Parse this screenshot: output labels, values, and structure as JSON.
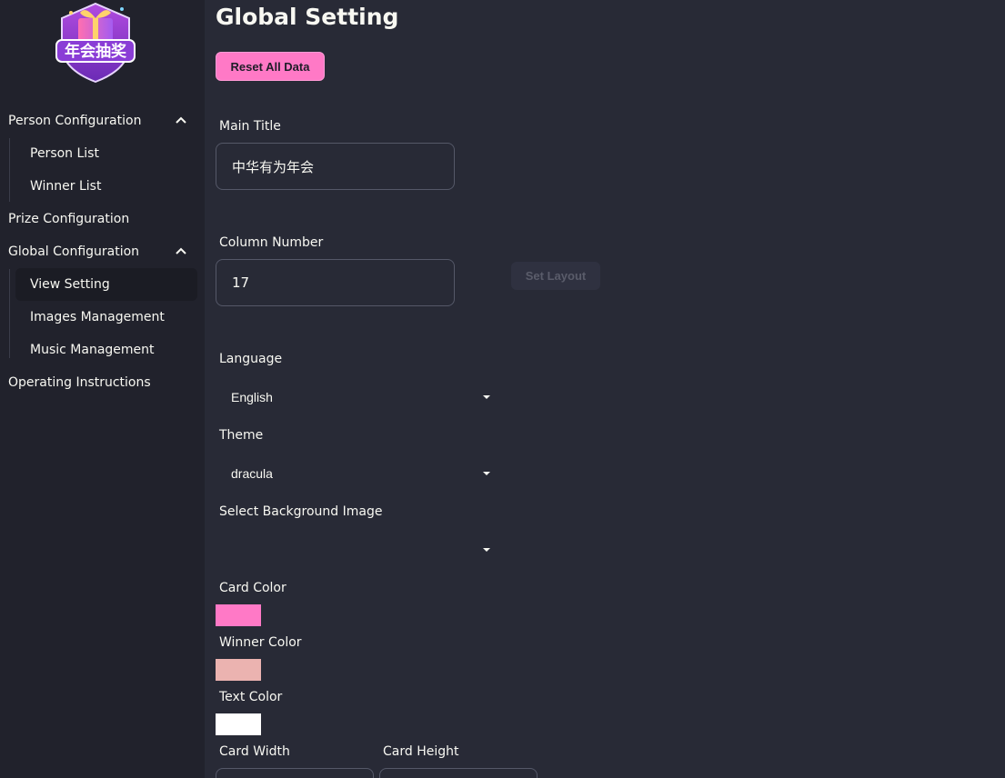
{
  "colors": {
    "background": "#282a36",
    "sidebar": "#21222c",
    "accent": "#ff79c6",
    "card_color": "#ff79c6",
    "winner_color": "#ebb3b0",
    "text_color": "#ffffff"
  },
  "logo": {
    "text": "年会抽奖"
  },
  "sidebar": {
    "items": [
      {
        "label": "Person Configuration",
        "icon": "chevron-up-icon"
      },
      {
        "label": "Person List"
      },
      {
        "label": "Winner List"
      },
      {
        "label": "Prize Configuration"
      },
      {
        "label": "Global Configuration",
        "icon": "chevron-up-icon"
      },
      {
        "label": "View Setting",
        "active": true
      },
      {
        "label": "Images Management"
      },
      {
        "label": "Music Management"
      },
      {
        "label": "Operating Instructions"
      }
    ]
  },
  "main": {
    "title": "Global Setting",
    "reset_label": "Reset All Data",
    "main_title": {
      "label": "Main Title",
      "value": "中华有为年会"
    },
    "column_number": {
      "label": "Column Number",
      "value": "17",
      "button": "Set Layout"
    },
    "language": {
      "label": "Language",
      "value": "English"
    },
    "theme": {
      "label": "Theme",
      "value": "dracula"
    },
    "background_image": {
      "label": "Select Background Image",
      "value": ""
    },
    "card_color": {
      "label": "Card Color"
    },
    "winner_color": {
      "label": "Winner Color"
    },
    "text_color": {
      "label": "Text Color"
    },
    "card_width": {
      "label": "Card Width"
    },
    "card_height": {
      "label": "Card Height"
    }
  }
}
